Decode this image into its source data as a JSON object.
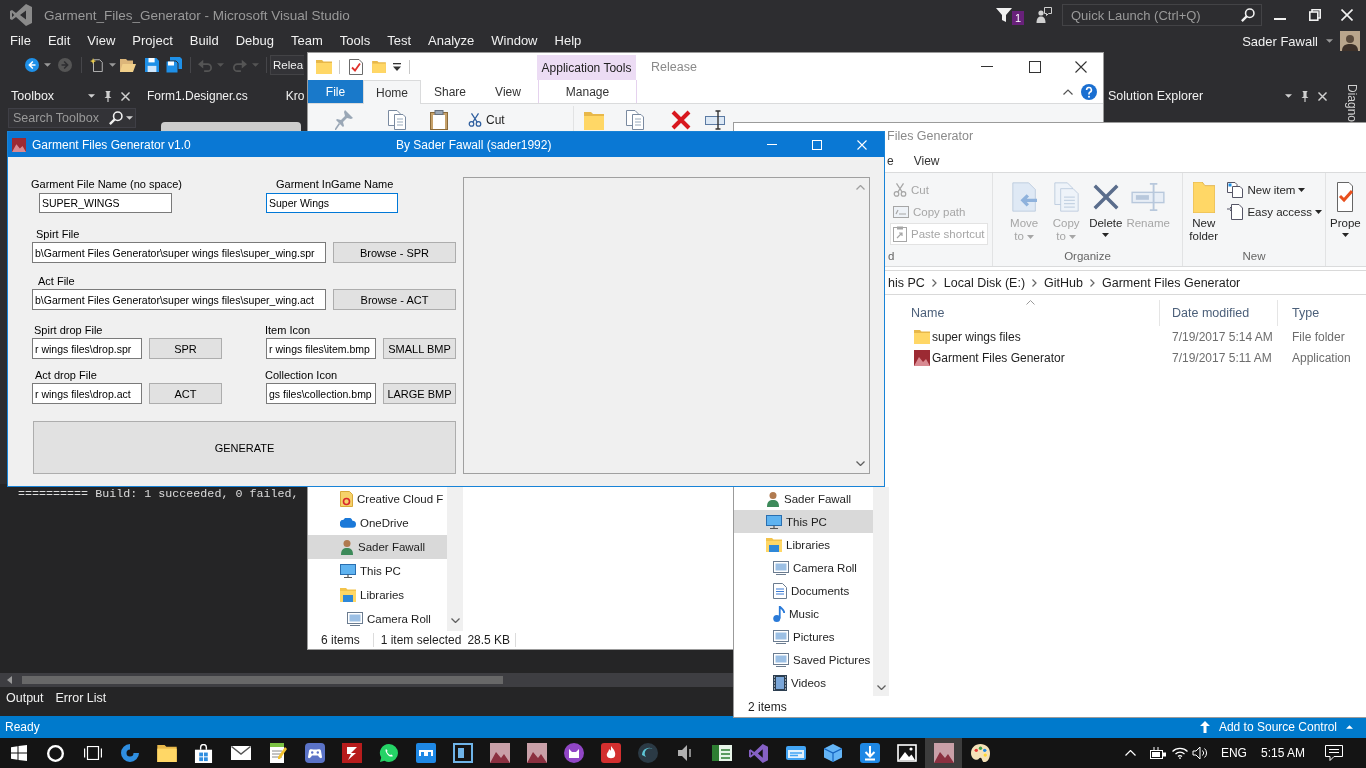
{
  "visual_studio": {
    "title": "Garment_Files_Generator - Microsoft Visual Studio",
    "notification_count": "1",
    "quick_launch": {
      "placeholder": "Quick Launch (Ctrl+Q)"
    },
    "menu": [
      "File",
      "Edit",
      "View",
      "Project",
      "Build",
      "Debug",
      "Team",
      "Tools",
      "Test",
      "Analyze",
      "Window",
      "Help"
    ],
    "account": "Sader Fawall",
    "configuration": "Relea",
    "toolbox": {
      "title": "Toolbox",
      "search": {
        "placeholder": "Search Toolbox"
      }
    },
    "document_tabs": [
      "Form1.Designer.cs",
      "Kro"
    ],
    "solution_explorer": {
      "title": "Solution Explorer"
    },
    "side_tab": "Diagno",
    "output_lines": [
      "========== Build: 1 succeeded, 0 failed,"
    ],
    "panel_tabs": [
      "Output",
      "Error List"
    ],
    "status_bar": {
      "text": "Ready",
      "source_control": "Add to Source Control"
    }
  },
  "explorer_back": {
    "title": "Release",
    "context_group": "Application Tools",
    "tabs": [
      {
        "label": "File",
        "kind": "backstage",
        "selected": false
      },
      {
        "label": "Home",
        "kind": "tab",
        "selected": true
      },
      {
        "label": "Share",
        "kind": "tab",
        "selected": false
      },
      {
        "label": "View",
        "kind": "tab",
        "selected": false
      },
      {
        "label": "Manage",
        "kind": "context",
        "selected": false
      }
    ],
    "ribbon_commands": [
      {
        "label": "Cut",
        "kind": "cut"
      }
    ],
    "nav": [
      {
        "label": "Creative Cloud F",
        "kind": "cloudfiles",
        "selected": false
      },
      {
        "label": "OneDrive",
        "kind": "cloud",
        "selected": false
      },
      {
        "label": "Sader Fawall",
        "kind": "user",
        "selected": true
      },
      {
        "label": "This PC",
        "kind": "computer",
        "selected": false
      },
      {
        "label": "Libraries",
        "kind": "library",
        "selected": false,
        "children": [
          {
            "label": "Camera Roll",
            "kind": "pictures",
            "selected": false
          }
        ]
      }
    ],
    "status_bar": {
      "item_count": "6 items",
      "selection": "1 item selected",
      "size": "28.5 KB"
    }
  },
  "explorer_front": {
    "title": "Files Generator",
    "tabs": [
      {
        "label": "e",
        "selected": false
      },
      {
        "label": "View",
        "selected": false
      }
    ],
    "ribbon_groups": [
      {
        "label": "d",
        "commands": [
          {
            "label": "Cut",
            "kind": "cut",
            "large": false,
            "dropdown": false,
            "split": false,
            "disabled": true,
            "highlighted": false
          },
          {
            "label": "Copy path",
            "kind": "path",
            "large": false,
            "dropdown": false,
            "split": false,
            "disabled": true,
            "highlighted": false
          },
          {
            "label": "Paste shortcut",
            "kind": "shortcut",
            "large": false,
            "dropdown": false,
            "split": false,
            "disabled": true,
            "highlighted": true
          }
        ]
      },
      {
        "label": "Organize",
        "commands": [
          {
            "label": "Move to",
            "kind": "move",
            "large": true,
            "dropdown": true,
            "split": false,
            "disabled": true,
            "highlighted": false
          },
          {
            "label": "Copy to",
            "kind": "copy",
            "large": true,
            "dropdown": true,
            "split": false,
            "disabled": true,
            "highlighted": false
          },
          {
            "label": "Delete",
            "kind": "delete",
            "large": true,
            "dropdown": false,
            "split": true,
            "disabled": false,
            "highlighted": false
          },
          {
            "label": "Rename",
            "kind": "rename",
            "large": true,
            "dropdown": false,
            "split": false,
            "disabled": true,
            "highlighted": false
          }
        ]
      },
      {
        "label": "New",
        "commands": [
          {
            "label": "New folder",
            "kind": "newfolder",
            "large": true,
            "dropdown": false,
            "split": false,
            "disabled": false,
            "highlighted": false
          },
          {
            "label": "New item",
            "kind": "newitem",
            "large": false,
            "dropdown": true,
            "split": false,
            "disabled": false,
            "highlighted": false
          },
          {
            "label": "Easy access",
            "kind": "access",
            "large": false,
            "dropdown": true,
            "split": false,
            "disabled": false,
            "highlighted": false
          }
        ]
      },
      {
        "commands": [
          {
            "label": "Prope",
            "kind": "properties",
            "large": true,
            "dropdown": false,
            "split": true,
            "disabled": false,
            "highlighted": false
          }
        ]
      }
    ],
    "address": [
      "his PC",
      "Local Disk (E:)",
      "GitHub",
      "Garment Files Generator"
    ],
    "columns": [
      {
        "label": "Name",
        "sorted": true
      },
      {
        "label": "Date modified",
        "sorted": false
      },
      {
        "label": "Type",
        "sorted": false
      }
    ],
    "rows": [
      {
        "name": "super wings files",
        "kind": "folder",
        "date": "7/19/2017 5:14 AM",
        "type": "File folder"
      },
      {
        "name": "Garment Files Generator",
        "kind": "application",
        "date": "7/19/2017 5:11 AM",
        "type": "Application"
      }
    ],
    "nav": [
      {
        "label": "Sader Fawall",
        "kind": "user",
        "selected": false
      },
      {
        "label": "This PC",
        "kind": "computer",
        "selected": true
      },
      {
        "label": "Libraries",
        "kind": "library",
        "selected": false,
        "children": [
          {
            "label": "Camera Roll",
            "kind": "pictures",
            "selected": false
          },
          {
            "label": "Documents",
            "kind": "documents",
            "selected": false
          },
          {
            "label": "Music",
            "kind": "music",
            "selected": false
          },
          {
            "label": "Pictures",
            "kind": "pictures",
            "selected": false
          },
          {
            "label": "Saved Pictures",
            "kind": "pictures",
            "selected": false
          },
          {
            "label": "Videos",
            "kind": "videos",
            "selected": false
          }
        ]
      }
    ],
    "status_bar": {
      "item_count": "2 items"
    }
  },
  "app": {
    "title": "Garment Files Generator v1.0",
    "author": "By Sader Fawall (sader1992)",
    "name_fields": [
      {
        "label": "Garment File Name (no space)",
        "value": "SUPER_WINGS",
        "focused": false
      },
      {
        "label": "Garment InGame Name",
        "value": "Super Wings",
        "focused": true
      }
    ],
    "path_fields": [
      {
        "label": "Spirt File",
        "value": "b\\Garment Files Generator\\super wings files\\super_wing.spr",
        "button": "Browse - SPR"
      },
      {
        "label": "Act File",
        "value": "b\\Garment Files Generator\\super wings files\\super_wing.act",
        "button": "Browse - ACT"
      }
    ],
    "short_fields": [
      {
        "label": "Spirt drop File",
        "value": "r wings files\\drop.spr",
        "button": "SPR"
      },
      {
        "label": "Item Icon",
        "value": "r wings files\\item.bmp",
        "button": "SMALL BMP"
      },
      {
        "label": "Act drop File",
        "value": "r wings files\\drop.act",
        "button": "ACT"
      },
      {
        "label": "Collection Icon",
        "value": "gs files\\collection.bmp",
        "button": "LARGE BMP"
      }
    ],
    "generate_button": "GENERATE"
  },
  "taskbar": {
    "apps": [
      {
        "kind": "browser",
        "selected": false
      },
      {
        "kind": "folder",
        "selected": false
      },
      {
        "kind": "store",
        "selected": false
      },
      {
        "kind": "mail",
        "selected": false
      },
      {
        "kind": "notepad",
        "selected": false
      },
      {
        "kind": "gamepad",
        "selected": false
      },
      {
        "kind": "ftp",
        "selected": false
      },
      {
        "kind": "messenger",
        "selected": false
      },
      {
        "kind": "tile",
        "selected": false
      },
      {
        "kind": "frame",
        "selected": false
      },
      {
        "kind": "thumbnail",
        "selected": false
      },
      {
        "kind": "thumbnail",
        "selected": false
      },
      {
        "kind": "cat",
        "selected": false
      },
      {
        "kind": "flame",
        "selected": false
      },
      {
        "kind": "orb",
        "selected": false
      },
      {
        "kind": "speaker",
        "selected": false
      },
      {
        "kind": "sheet",
        "selected": false
      },
      {
        "kind": "studio",
        "selected": false
      },
      {
        "kind": "window",
        "selected": false
      },
      {
        "kind": "cube",
        "selected": false
      },
      {
        "kind": "download",
        "selected": false
      },
      {
        "kind": "photos",
        "selected": false
      },
      {
        "kind": "thumbnail",
        "selected": true
      },
      {
        "kind": "palette",
        "selected": false
      }
    ],
    "language": "ENG",
    "time": "5:15 AM"
  }
}
